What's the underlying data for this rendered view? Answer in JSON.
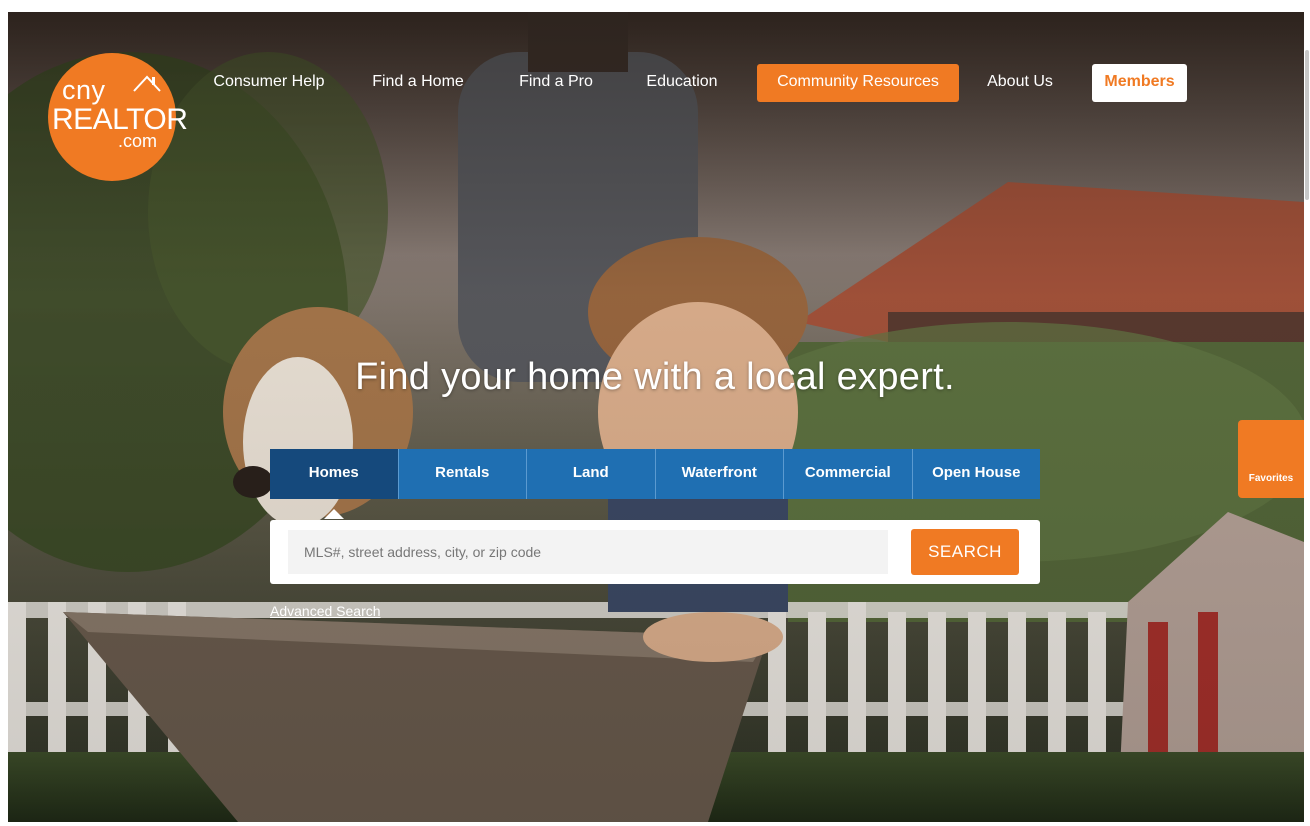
{
  "logo": {
    "line1": "cny",
    "line2": "REALTOR",
    "line3": ".com"
  },
  "nav": {
    "items": [
      {
        "label": "Consumer Help"
      },
      {
        "label": "Find a Home"
      },
      {
        "label": "Find a Pro"
      },
      {
        "label": "Education"
      },
      {
        "label": "Community Resources"
      },
      {
        "label": "About Us"
      }
    ],
    "members_label": "Members"
  },
  "hero": {
    "headline": "Find your home with a local expert."
  },
  "search": {
    "tabs": [
      {
        "label": "Homes",
        "active": true
      },
      {
        "label": "Rentals",
        "active": false
      },
      {
        "label": "Land",
        "active": false
      },
      {
        "label": "Waterfront",
        "active": false
      },
      {
        "label": "Commercial",
        "active": false
      },
      {
        "label": "Open House",
        "active": false
      }
    ],
    "placeholder": "MLS#, street address, city, or zip code",
    "value": "",
    "button_label": "SEARCH",
    "advanced_label": "Advanced Search"
  },
  "favorites": {
    "label": "Favorites"
  },
  "colors": {
    "brand_orange": "#f07a23",
    "tab_blue": "#1f6fb2",
    "tab_active": "#15497c"
  }
}
